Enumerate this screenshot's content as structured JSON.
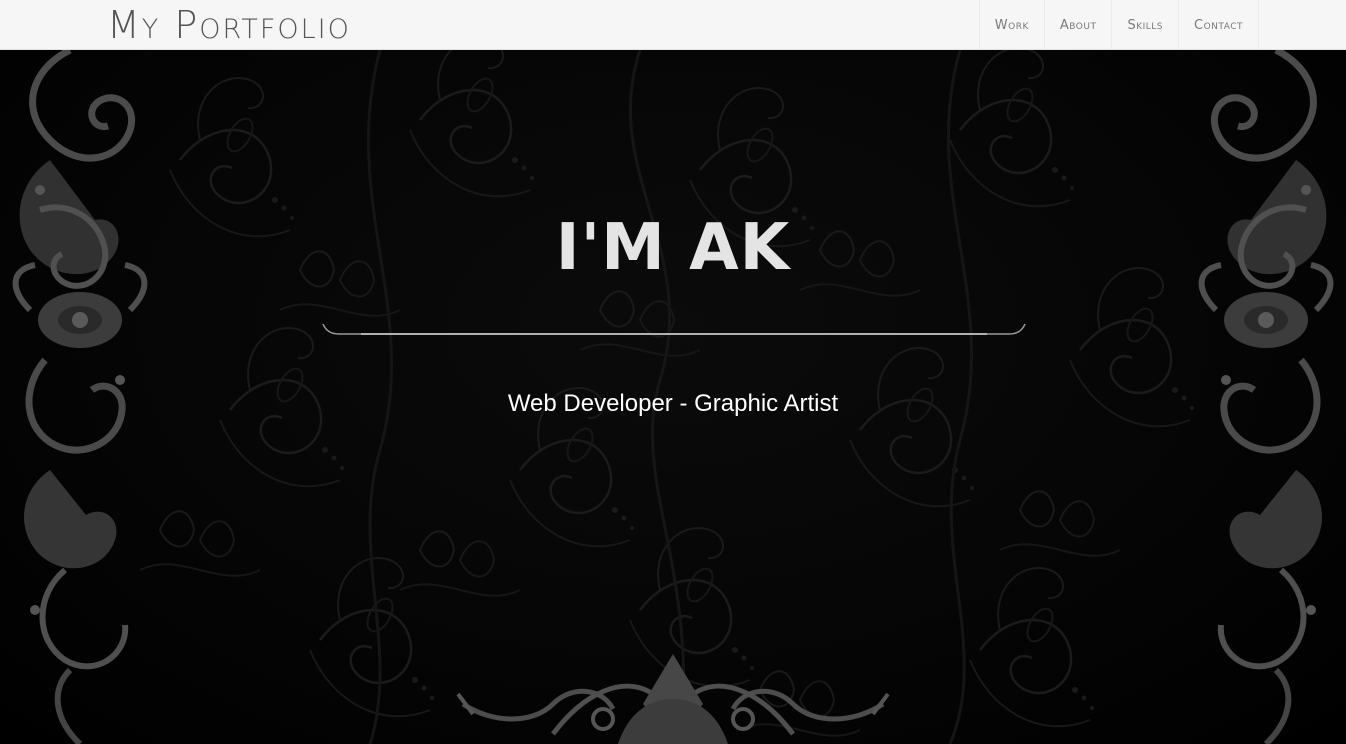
{
  "navbar": {
    "brand": "My Portfolio",
    "items": [
      {
        "label": "Work"
      },
      {
        "label": "About"
      },
      {
        "label": "Skills"
      },
      {
        "label": "Contact"
      }
    ]
  },
  "hero": {
    "title": "I'M AK",
    "subtitle": "Web Developer - Graphic Artist"
  },
  "colors": {
    "navbar_bg": "#f6f6f6",
    "background": "#030303",
    "ornament": "#4a4a4a",
    "title": "#e4e4e4"
  }
}
